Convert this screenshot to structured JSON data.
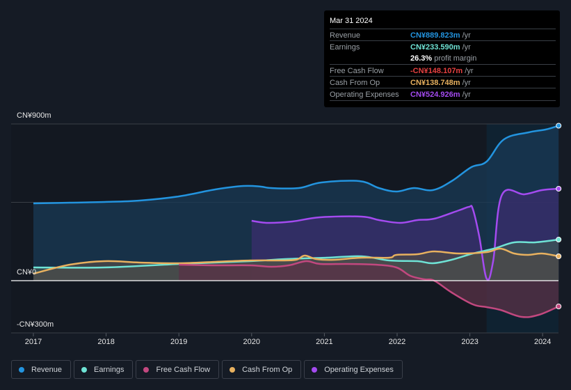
{
  "tooltip": {
    "date": "Mar 31 2024",
    "rows": [
      {
        "label": "Revenue",
        "value": "CN¥889.823m",
        "unit": " /yr",
        "color": "#2394df"
      },
      {
        "label": "Earnings",
        "value": "CN¥233.590m",
        "unit": " /yr",
        "color": "#6fe3d5"
      },
      {
        "label": "",
        "value": "26.3%",
        "unit": " profit margin",
        "color": "#ffffff"
      },
      {
        "label": "Free Cash Flow",
        "value": "-CN¥148.107m",
        "unit": " /yr",
        "color": "#e64141"
      },
      {
        "label": "Cash From Op",
        "value": "CN¥138.748m",
        "unit": " /yr",
        "color": "#e8b15f"
      },
      {
        "label": "Operating Expenses",
        "value": "CN¥524.926m",
        "unit": " /yr",
        "color": "#a44bf0"
      }
    ]
  },
  "legend": [
    {
      "label": "Revenue",
      "color": "#2394df"
    },
    {
      "label": "Earnings",
      "color": "#6fe3d5"
    },
    {
      "label": "Free Cash Flow",
      "color": "#c2487f"
    },
    {
      "label": "Cash From Op",
      "color": "#e8b15f"
    },
    {
      "label": "Operating Expenses",
      "color": "#a44bf0"
    }
  ],
  "chart_data": {
    "type": "area",
    "title": "",
    "xlabel": "",
    "ylabel": "",
    "y_unit": "CN¥m",
    "ylim": [
      -300,
      900
    ],
    "xlim": [
      2016.7,
      2024.22
    ],
    "y_ticks": [
      {
        "value": 900,
        "label": "CN¥900m"
      },
      {
        "value": 0,
        "label": "CN¥0"
      },
      {
        "value": -300,
        "label": "-CN¥300m"
      }
    ],
    "x_ticks": [
      {
        "value": 2017,
        "label": "2017"
      },
      {
        "value": 2018,
        "label": "2018"
      },
      {
        "value": 2019,
        "label": "2019"
      },
      {
        "value": 2020,
        "label": "2020"
      },
      {
        "value": 2021,
        "label": "2021"
      },
      {
        "value": 2022,
        "label": "2022"
      },
      {
        "value": 2023,
        "label": "2023"
      },
      {
        "value": 2024,
        "label": "2024"
      }
    ],
    "highlight_from": 2023.23,
    "grid": true,
    "legend_position": "bottom-left",
    "series": [
      {
        "name": "Revenue",
        "color": "#2394df",
        "fill": "#1a3a55",
        "points": [
          [
            2017.0,
            444
          ],
          [
            2017.5,
            448
          ],
          [
            2017.98,
            452
          ],
          [
            2018.46,
            460
          ],
          [
            2019.0,
            484
          ],
          [
            2019.5,
            524
          ],
          [
            2019.89,
            544
          ],
          [
            2020.13,
            540
          ],
          [
            2020.27,
            532
          ],
          [
            2020.65,
            532
          ],
          [
            2020.96,
            564
          ],
          [
            2021.48,
            572
          ],
          [
            2021.75,
            532
          ],
          [
            2021.99,
            512
          ],
          [
            2022.23,
            532
          ],
          [
            2022.49,
            520
          ],
          [
            2022.75,
            572
          ],
          [
            2023.02,
            652
          ],
          [
            2023.23,
            684
          ],
          [
            2023.47,
            812
          ],
          [
            2023.81,
            852
          ],
          [
            2024.04,
            868
          ],
          [
            2024.22,
            890
          ]
        ]
      },
      {
        "name": "Operating Expenses",
        "color": "#a44bf0",
        "fill": "#3b2e6e",
        "points": [
          [
            2020.0,
            344
          ],
          [
            2020.22,
            332
          ],
          [
            2020.56,
            340
          ],
          [
            2020.94,
            364
          ],
          [
            2021.51,
            368
          ],
          [
            2021.75,
            348
          ],
          [
            2022.04,
            332
          ],
          [
            2022.28,
            348
          ],
          [
            2022.51,
            356
          ],
          [
            2022.85,
            404
          ],
          [
            2022.99,
            424
          ],
          [
            2023.04,
            412
          ],
          [
            2023.13,
            252
          ],
          [
            2023.23,
            12
          ],
          [
            2023.32,
            112
          ],
          [
            2023.44,
            492
          ],
          [
            2023.75,
            496
          ],
          [
            2023.99,
            520
          ],
          [
            2024.22,
            528
          ]
        ]
      },
      {
        "name": "Earnings",
        "color": "#6fe3d5",
        "fill": "#3d5656",
        "points": [
          [
            2017.0,
            76
          ],
          [
            2017.98,
            76
          ],
          [
            2019.0,
            96
          ],
          [
            2019.98,
            112
          ],
          [
            2020.46,
            124
          ],
          [
            2021.03,
            132
          ],
          [
            2021.51,
            140
          ],
          [
            2021.89,
            116
          ],
          [
            2022.28,
            112
          ],
          [
            2022.49,
            100
          ],
          [
            2022.75,
            120
          ],
          [
            2023.04,
            156
          ],
          [
            2023.33,
            184
          ],
          [
            2023.61,
            220
          ],
          [
            2023.9,
            220
          ],
          [
            2024.22,
            236
          ]
        ]
      },
      {
        "name": "Cash From Op",
        "color": "#e8b15f",
        "fill": "#4e4a48",
        "points": [
          [
            2017.0,
            40
          ],
          [
            2017.5,
            92
          ],
          [
            2017.98,
            112
          ],
          [
            2018.46,
            104
          ],
          [
            2019.0,
            100
          ],
          [
            2019.5,
            108
          ],
          [
            2019.98,
            116
          ],
          [
            2020.37,
            116
          ],
          [
            2020.61,
            120
          ],
          [
            2020.73,
            144
          ],
          [
            2020.89,
            124
          ],
          [
            2021.13,
            120
          ],
          [
            2021.51,
            132
          ],
          [
            2021.89,
            132
          ],
          [
            2021.99,
            148
          ],
          [
            2022.28,
            152
          ],
          [
            2022.51,
            168
          ],
          [
            2022.85,
            156
          ],
          [
            2023.23,
            164
          ],
          [
            2023.42,
            184
          ],
          [
            2023.61,
            156
          ],
          [
            2023.8,
            148
          ],
          [
            2023.99,
            156
          ],
          [
            2024.22,
            140
          ]
        ]
      },
      {
        "name": "Free Cash Flow",
        "color": "#c2487f",
        "fill": "#5a3247",
        "points": [
          [
            2019.0,
            92
          ],
          [
            2019.5,
            88
          ],
          [
            2019.98,
            88
          ],
          [
            2020.27,
            80
          ],
          [
            2020.51,
            88
          ],
          [
            2020.75,
            112
          ],
          [
            2020.94,
            96
          ],
          [
            2021.32,
            96
          ],
          [
            2021.7,
            92
          ],
          [
            2021.99,
            76
          ],
          [
            2022.18,
            28
          ],
          [
            2022.37,
            8
          ],
          [
            2022.51,
            0
          ],
          [
            2022.75,
            -68
          ],
          [
            2023.04,
            -136
          ],
          [
            2023.23,
            -152
          ],
          [
            2023.42,
            -168
          ],
          [
            2023.71,
            -208
          ],
          [
            2023.95,
            -196
          ],
          [
            2024.22,
            -148
          ]
        ]
      }
    ]
  }
}
